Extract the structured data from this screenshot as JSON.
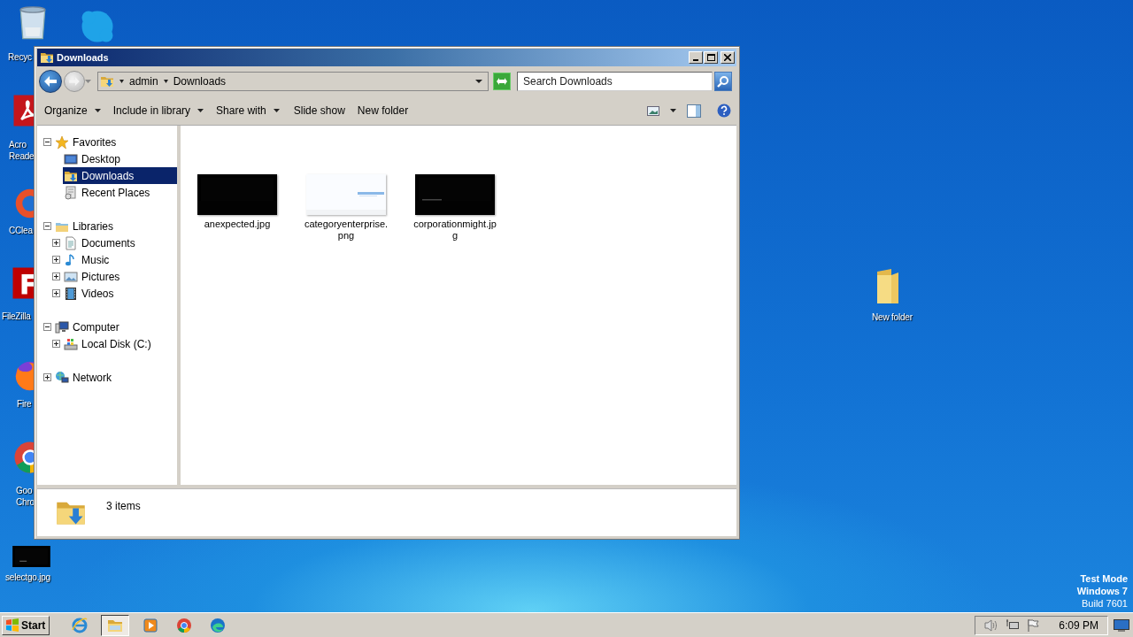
{
  "desktop": {
    "icons": [
      {
        "kind": "recycle-bin",
        "label": "Recyc"
      },
      {
        "kind": "chat-app"
      },
      {
        "kind": "pdf-reader",
        "label": "Acro\nReade"
      },
      {
        "kind": "cleaner",
        "label": "CClea"
      },
      {
        "kind": "ftp-client",
        "label": "FileZilla"
      },
      {
        "kind": "fox-browser",
        "label": "Fire"
      },
      {
        "kind": "chrome-browser",
        "label": "Goo\nChro"
      },
      {
        "kind": "image-file",
        "label": "selectgo.jpg"
      },
      {
        "kind": "folder",
        "label": "New folder"
      }
    ],
    "os_notice": [
      "Test Mode",
      "Windows 7",
      "Build 7601"
    ]
  },
  "window": {
    "title": "Downloads",
    "address": {
      "crumbs": [
        "admin",
        "Downloads"
      ]
    },
    "search": {
      "placeholder": "Search Downloads"
    },
    "commands": [
      {
        "label": "Organize",
        "menu": true
      },
      {
        "label": "Include in library",
        "menu": true
      },
      {
        "label": "Share with",
        "menu": true
      },
      {
        "label": "Slide show",
        "menu": false
      },
      {
        "label": "New folder",
        "menu": false
      }
    ],
    "nav_tree": [
      {
        "label": "Favorites",
        "kind": "star",
        "expanded": true,
        "selected": false,
        "children": [
          {
            "label": "Desktop",
            "kind": "desktop",
            "selected": false
          },
          {
            "label": "Downloads",
            "kind": "downloads",
            "selected": true
          },
          {
            "label": "Recent Places",
            "kind": "recent",
            "selected": false
          }
        ]
      },
      {
        "label": "Libraries",
        "kind": "libraries",
        "expanded": true,
        "selected": false,
        "children": [
          {
            "label": "Documents",
            "kind": "documents",
            "expanded": false,
            "selected": false
          },
          {
            "label": "Music",
            "kind": "music",
            "expanded": false,
            "selected": false
          },
          {
            "label": "Pictures",
            "kind": "pictures",
            "expanded": false,
            "selected": false
          },
          {
            "label": "Videos",
            "kind": "videos",
            "expanded": false,
            "selected": false
          }
        ]
      },
      {
        "label": "Computer",
        "kind": "computer",
        "expanded": true,
        "selected": false,
        "children": [
          {
            "label": "Local Disk (C:)",
            "kind": "disk",
            "expanded": false,
            "selected": false
          }
        ]
      },
      {
        "label": "Network",
        "kind": "network",
        "expanded": false,
        "selected": false
      }
    ],
    "files": [
      {
        "name": "anexpected.jpg",
        "kind": "picture"
      },
      {
        "name": "categoryenterprise.png",
        "kind": "picture"
      },
      {
        "name": "corporationmight.jpg",
        "kind": "picture"
      }
    ],
    "status": {
      "item_count": "3 items"
    }
  },
  "taskbar": {
    "start": "Start",
    "apps": [
      {
        "kind": "ie",
        "selected": false
      },
      {
        "kind": "explorer",
        "selected": true
      },
      {
        "kind": "media",
        "selected": false
      },
      {
        "kind": "chrome",
        "selected": false
      },
      {
        "kind": "edge",
        "selected": false
      }
    ],
    "clock": "6:09 PM"
  }
}
